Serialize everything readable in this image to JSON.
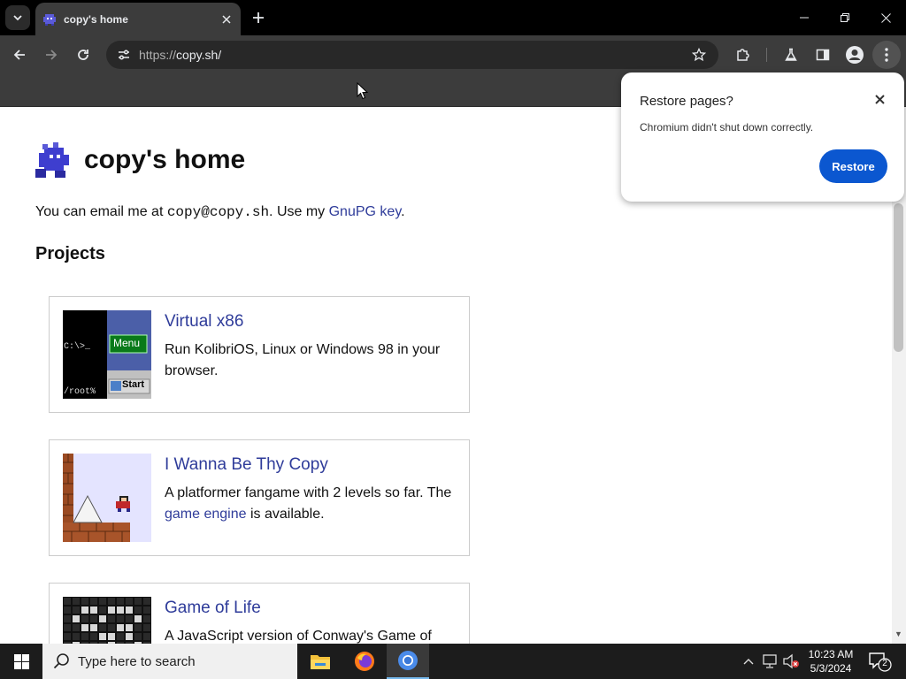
{
  "browser": {
    "tab_title": "copy's home",
    "url_scheme": "https://",
    "url_host": "copy.sh/",
    "accent": "#0b57d0"
  },
  "page": {
    "title": "copy's home",
    "intro_prefix": "You can email me at ",
    "email": "copy@copy.sh",
    "intro_middle": ". Use my ",
    "gpg_link": "GnuPG key",
    "intro_suffix": ".",
    "projects_heading": "Projects",
    "link_color": "#2f3c9a",
    "projects": [
      {
        "title": "Virtual x86",
        "desc": "Run KolibriOS, Linux or Windows 98 in your browser.",
        "thumb_text": {
          "prompt": "C:\\>_",
          "menu": "Menu",
          "root": "/root%",
          "start": "Start"
        }
      },
      {
        "title": "I Wanna Be Thy Copy",
        "desc_prefix": "A platformer fangame with 2 levels so far. The ",
        "desc_link": "game engine",
        "desc_suffix": " is available."
      },
      {
        "title": "Game of Life",
        "desc": "A JavaScript version of Conway's Game of"
      }
    ]
  },
  "restore_popup": {
    "title": "Restore pages?",
    "message": "Chromium didn't shut down correctly.",
    "button": "Restore"
  },
  "taskbar": {
    "search_placeholder": "Type here to search",
    "time": "10:23 AM",
    "date": "5/3/2024",
    "notification_count": "2"
  }
}
